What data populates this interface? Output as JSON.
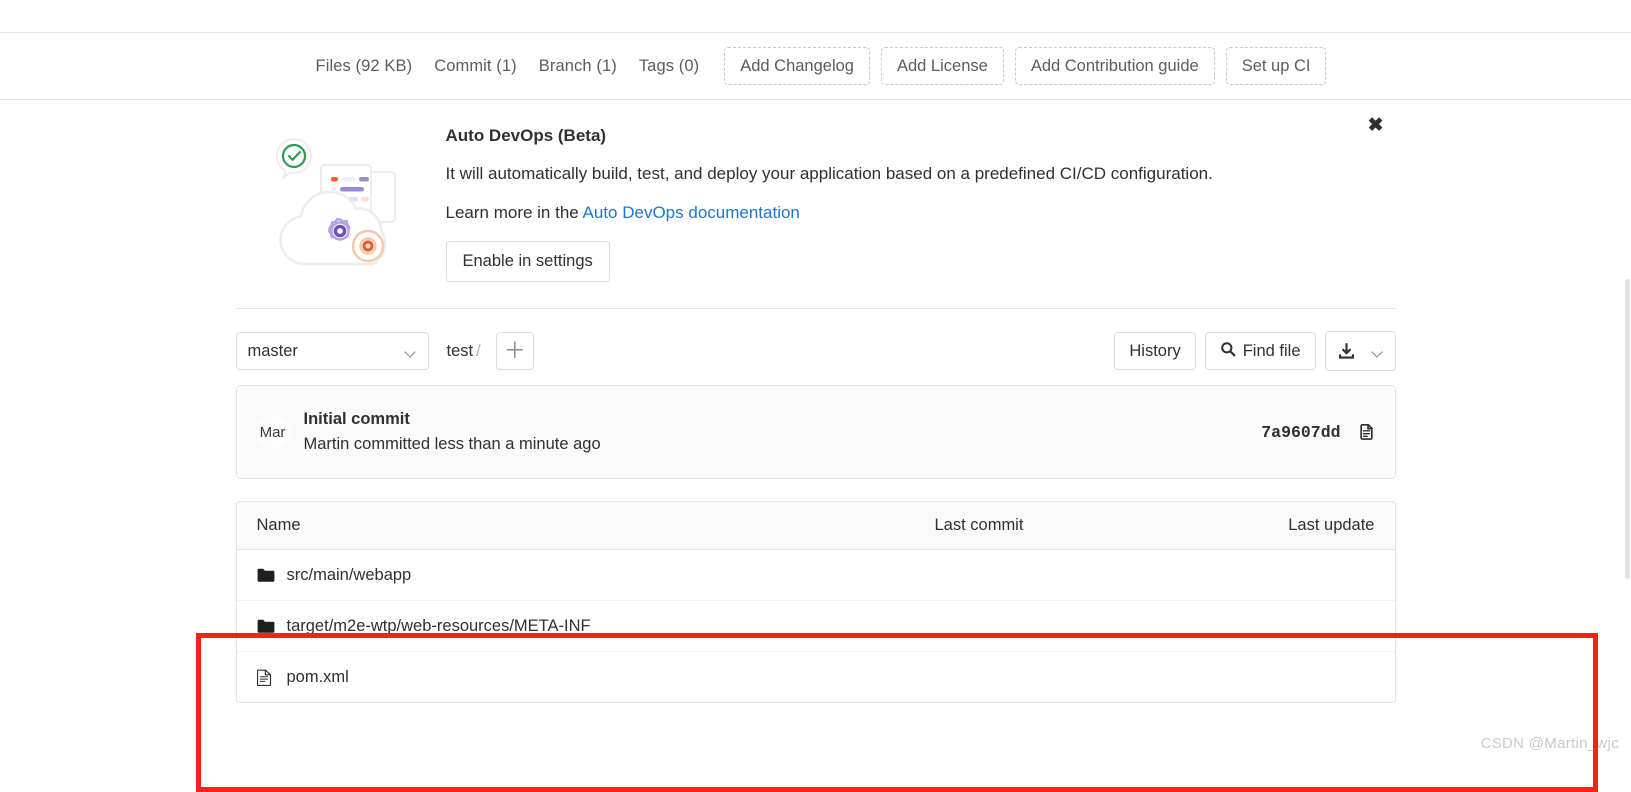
{
  "repo_nav": {
    "stats": [
      {
        "label": "Files (92 KB)",
        "name": "files"
      },
      {
        "label": "Commit (1)",
        "name": "commit"
      },
      {
        "label": "Branch (1)",
        "name": "branch"
      },
      {
        "label": "Tags (0)",
        "name": "tags"
      }
    ],
    "actions": [
      {
        "label": "Add Changelog",
        "name": "add-changelog"
      },
      {
        "label": "Add License",
        "name": "add-license"
      },
      {
        "label": "Add Contribution guide",
        "name": "add-contribution-guide"
      },
      {
        "label": "Set up CI",
        "name": "set-up-ci"
      }
    ]
  },
  "devops_banner": {
    "title": "Auto DevOps (Beta)",
    "description": "It will automatically build, test, and deploy your application based on a predefined CI/CD configuration.",
    "learn_prefix": "Learn more in the ",
    "learn_link": "Auto DevOps documentation",
    "enable_label": "Enable in settings",
    "close_glyph": "✖",
    "icon": "auto-devops-cloud-illustration"
  },
  "file_toolbar": {
    "branch": "master",
    "path_root": "test",
    "path_sep": "/",
    "add_glyph": "＋",
    "history_label": "History",
    "find_file_label": "Find file",
    "search_icon": "search-icon",
    "download_icon": "download-icon",
    "download_caret_icon": "chevron-down-icon"
  },
  "last_commit": {
    "avatar_initials": "Mar",
    "title": "Initial commit",
    "subtitle": "Martin committed less than a minute ago",
    "hash": "7a9607dd",
    "copy_icon": "copy-icon"
  },
  "file_tree": {
    "columns": {
      "name": "Name",
      "last_commit": "Last commit",
      "last_update": "Last update"
    },
    "rows": [
      {
        "name": "src/main/webapp",
        "type": "folder",
        "last_commit": "",
        "last_update": ""
      },
      {
        "name": "target/m2e-wtp/web-resources/META-INF",
        "type": "folder",
        "last_commit": "",
        "last_update": ""
      },
      {
        "name": "pom.xml",
        "type": "file",
        "last_commit": "",
        "last_update": ""
      }
    ]
  },
  "annotation": {
    "color": "#fb2018"
  },
  "watermark": {
    "text": "CSDN @Martin_wjc"
  }
}
